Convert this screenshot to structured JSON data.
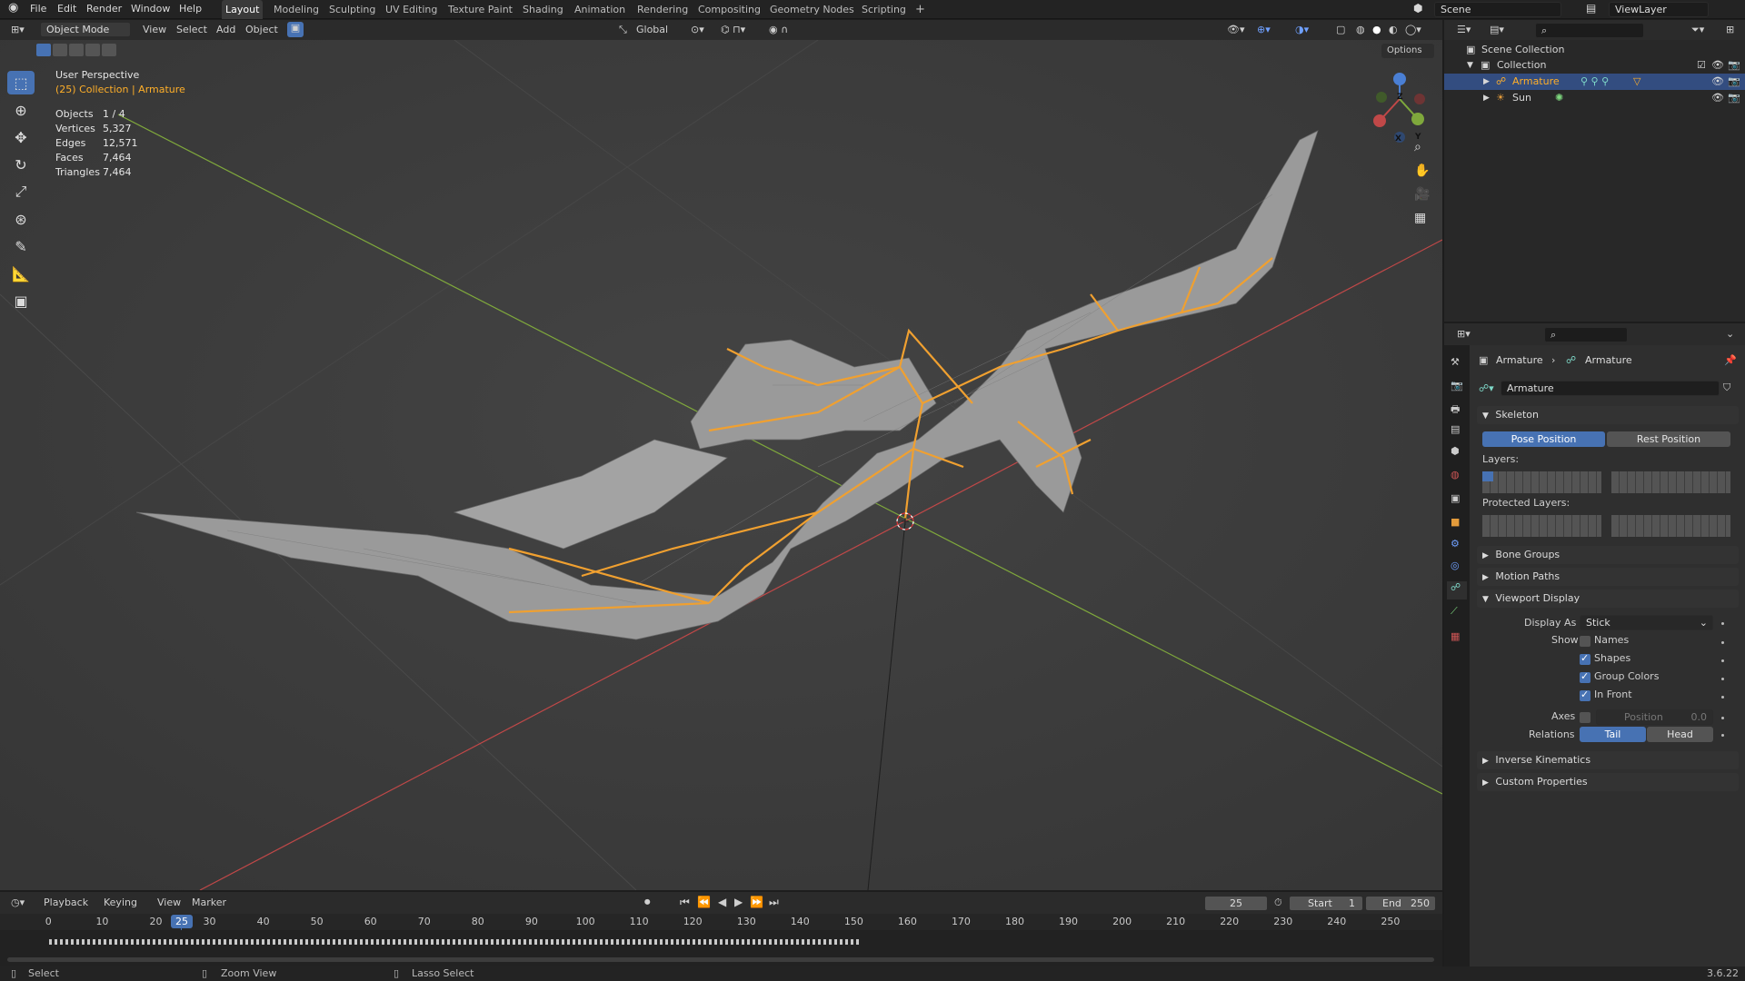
{
  "topbar": {
    "menus": [
      "File",
      "Edit",
      "Render",
      "Window",
      "Help"
    ],
    "workspaces": [
      "Layout",
      "Modeling",
      "Sculpting",
      "UV Editing",
      "Texture Paint",
      "Shading",
      "Animation",
      "Rendering",
      "Compositing",
      "Geometry Nodes",
      "Scripting"
    ],
    "active_workspace": "Layout",
    "add_tab": "+",
    "scene": "Scene",
    "view_layer": "ViewLayer"
  },
  "viewport_header": {
    "mode": "Object Mode",
    "menus": [
      "View",
      "Select",
      "Add",
      "Object"
    ],
    "orientation": "Global",
    "options": "Options"
  },
  "viewport": {
    "perspective": "User Perspective",
    "collection": "(25) Collection | Armature",
    "stats": [
      {
        "label": "Objects",
        "value": "1 / 4"
      },
      {
        "label": "Vertices",
        "value": "5,327"
      },
      {
        "label": "Edges",
        "value": "12,571"
      },
      {
        "label": "Faces",
        "value": "7,464"
      },
      {
        "label": "Triangles",
        "value": "7,464"
      }
    ],
    "gizmo_x": "X",
    "gizmo_y": "Y",
    "gizmo_z": "Z"
  },
  "outliner": {
    "scene_collection": "Scene Collection",
    "collection": "Collection",
    "items": [
      {
        "name": "Armature",
        "selected": true
      },
      {
        "name": "Sun",
        "selected": false
      }
    ]
  },
  "properties": {
    "breadcrumb_object": "Armature",
    "breadcrumb_data": "Armature",
    "data_name": "Armature",
    "skeleton_title": "Skeleton",
    "pose_position": "Pose Position",
    "rest_position": "Rest Position",
    "layers_label": "Layers:",
    "protected_layers_label": "Protected Layers:",
    "bone_groups": "Bone Groups",
    "motion_paths": "Motion Paths",
    "viewport_display": "Viewport Display",
    "display_as_label": "Display As",
    "display_as_value": "Stick",
    "show_label": "Show",
    "show_names": "Names",
    "show_shapes": "Shapes",
    "show_group_colors": "Group Colors",
    "show_in_front": "In Front",
    "axes_label": "Axes",
    "axes_position": "Position",
    "axes_value": "0.0",
    "relations_label": "Relations",
    "relations_tail": "Tail",
    "relations_head": "Head",
    "inverse_kinematics": "Inverse Kinematics",
    "custom_properties": "Custom Properties"
  },
  "timeline": {
    "menus": [
      "Playback",
      "Keying",
      "View",
      "Marker"
    ],
    "current_frame": "25",
    "start_label": "Start",
    "start_value": "1",
    "end_label": "End",
    "end_value": "250",
    "ticks": [
      "0",
      "10",
      "20",
      "30",
      "40",
      "50",
      "60",
      "70",
      "80",
      "90",
      "100",
      "110",
      "120",
      "130",
      "140",
      "150",
      "160",
      "170",
      "180",
      "190",
      "200",
      "210",
      "220",
      "230",
      "240",
      "250"
    ]
  },
  "status": {
    "select": "Select",
    "zoom": "Zoom View",
    "lasso": "Lasso Select",
    "version": "3.6.22"
  },
  "colors": {
    "accent": "#4772b3",
    "bone": "#f0a030",
    "x_axis": "#c04848",
    "y_axis": "#7fa83c",
    "selected_text": "#ffaf29"
  }
}
